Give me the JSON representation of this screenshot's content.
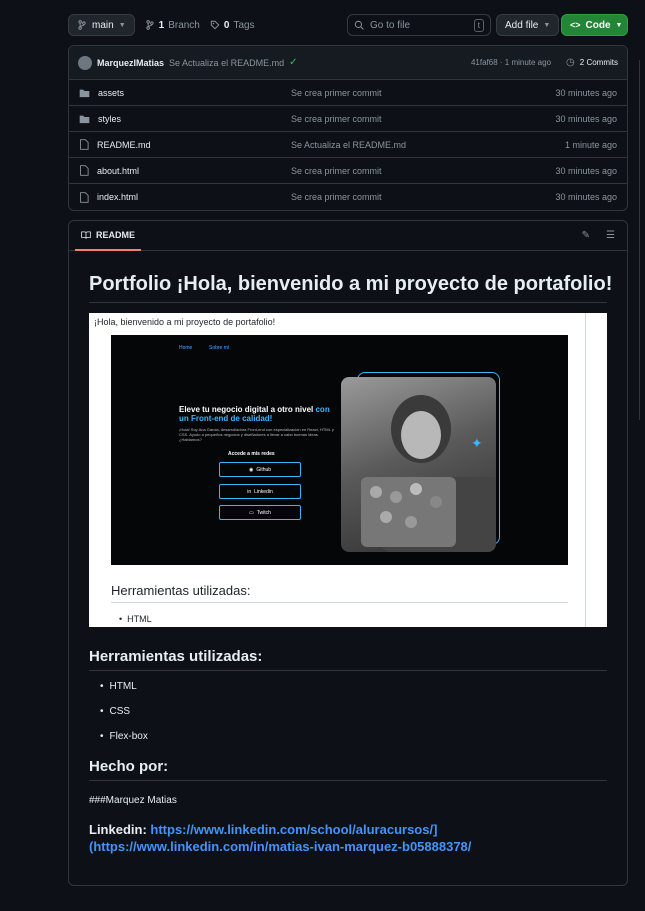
{
  "topbar": {
    "branch": "main",
    "branches_count": "1",
    "branches_label": "Branch",
    "tags_count": "0",
    "tags_label": "Tags",
    "search_placeholder": "Go to file",
    "search_kbd": "t",
    "add_file_label": "Add file",
    "code_label": "Code"
  },
  "commit": {
    "author": "MarquezIMatias",
    "message": "Se Actualiza el README.md",
    "hash_time": "41faf68 · 1 minute ago",
    "commits_label": "2 Commits"
  },
  "files": [
    {
      "name": "assets",
      "type": "folder",
      "message": "Se crea primer commit",
      "date": "30 minutes ago"
    },
    {
      "name": "styles",
      "type": "folder",
      "message": "Se crea primer commit",
      "date": "30 minutes ago"
    },
    {
      "name": "README.md",
      "type": "file",
      "message": "Se Actualiza el README.md",
      "date": "1 minute ago"
    },
    {
      "name": "about.html",
      "type": "file",
      "message": "Se crea primer commit",
      "date": "30 minutes ago"
    },
    {
      "name": "index.html",
      "type": "file",
      "message": "Se crea primer commit",
      "date": "30 minutes ago"
    }
  ],
  "readme": {
    "tab_label": "README",
    "title": "Portfolio ¡Hola, bienvenido a mi proyecto de portafolio!",
    "screenshot": {
      "caption": "¡Hola, bienvenido a mi proyecto de portafolio!",
      "nav_home": "Home",
      "nav_about": "Sobre mí",
      "hero_title": "Eleve tu negocio digital a otro nivel",
      "hero_title_accent": "con un Front-end de calidad!",
      "hero_text": "¡Hola! Soy Ana Garcia, desarrolladora Front-end con especialización en React, HTML y CSS. Ayudo a pequeños negocios y diseñadores a llevar a cabo buenas ideas. ¿Hablamos?",
      "hero_access": "Accede a mis redes",
      "btn_github": "Github",
      "btn_linkedin": "Linkedin",
      "btn_twitch": "Twitch",
      "section_title": "Herramientas utilizadas:",
      "section_item": "HTML"
    },
    "tools_title": "Herramientas utilizadas:",
    "tools": [
      "HTML",
      "CSS",
      "Flex-box"
    ],
    "made_by_title": "Hecho por:",
    "made_by_text": "###Marquez Matias",
    "linkedin_label": "Linkedin:",
    "linkedin_url": "https://www.linkedin.com/school/aluracursos/](https://www.linkedin.com/in/matias-ivan-marquez-b05888378/"
  },
  "colors": {
    "background": "#0d1117",
    "border": "#30363d",
    "accent_green": "#238636",
    "link": "#4493f8",
    "tab_underline": "#f78166"
  }
}
